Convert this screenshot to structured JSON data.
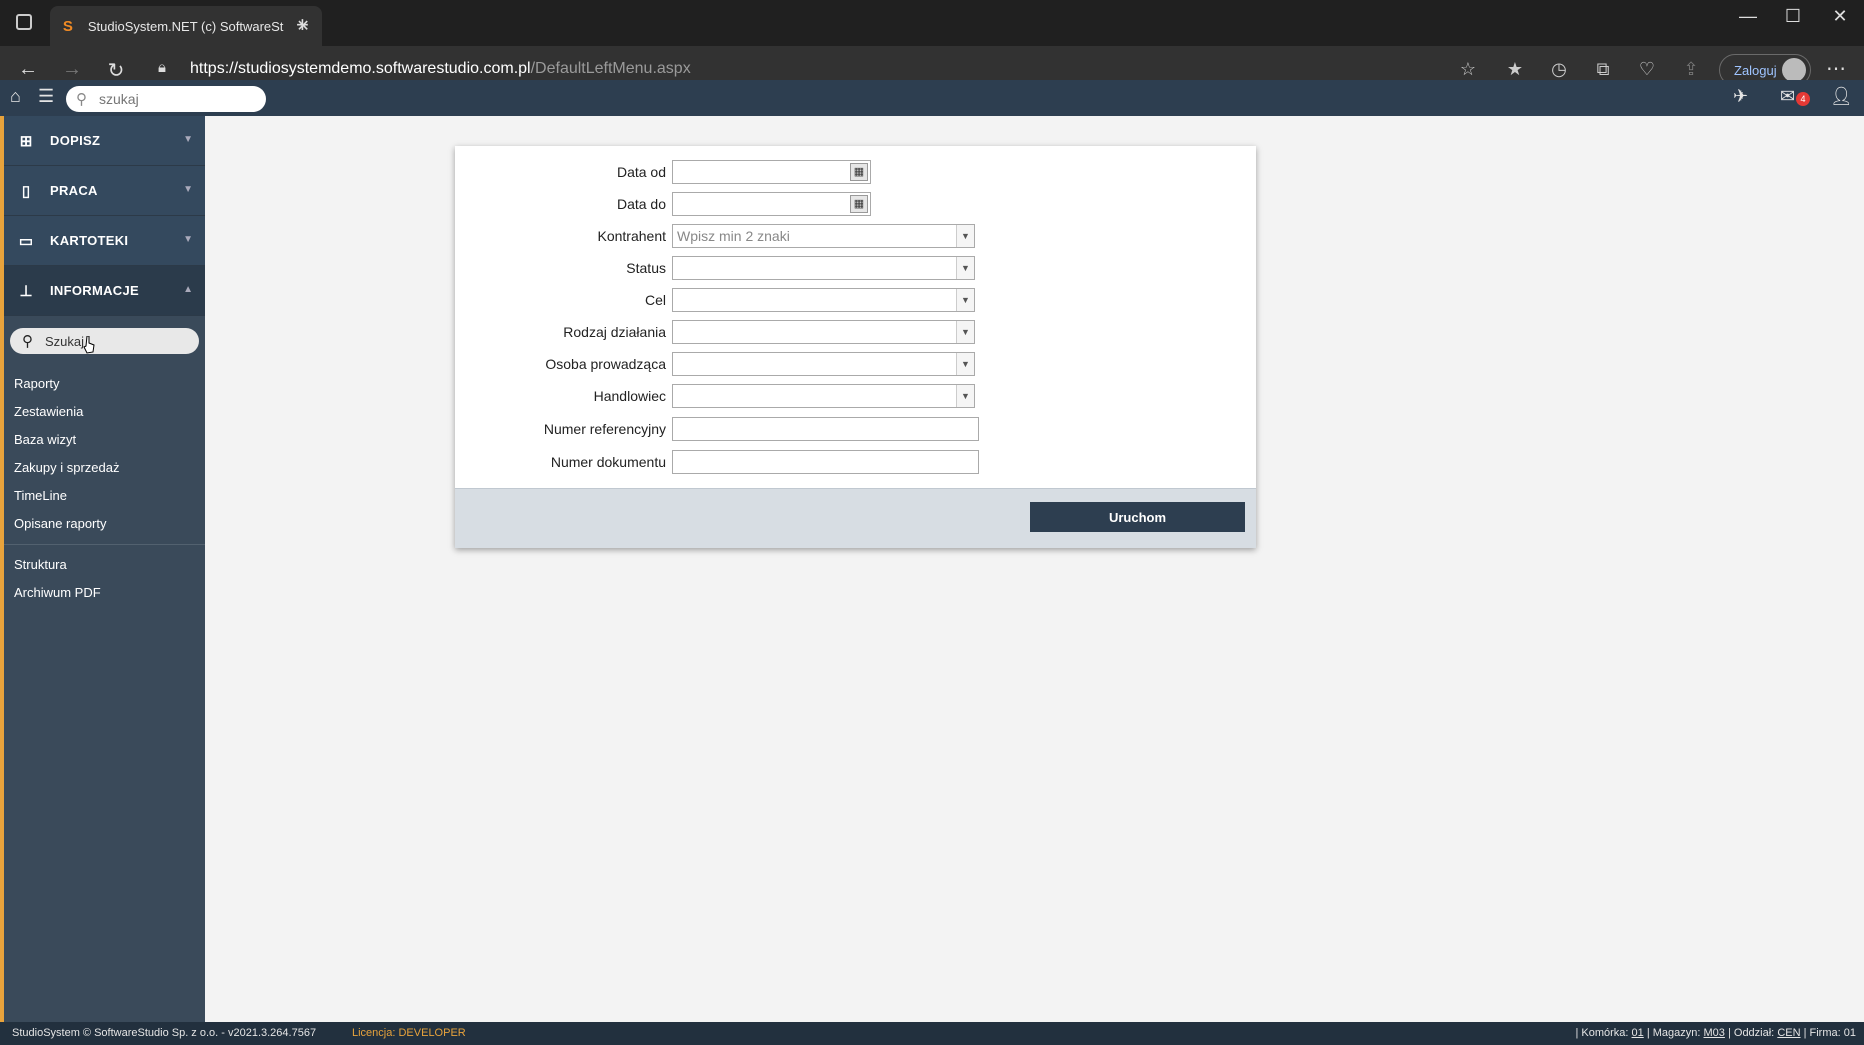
{
  "browser": {
    "tab_title": "StudioSystem.NET (c) SoftwareSt",
    "tab_favicon": "S",
    "url_main": "https://studiosystemdemo.softwarestudio.com.pl",
    "url_path": "/DefaultLeftMenu.aspx",
    "login_label": "Zaloguj"
  },
  "app": {
    "search_placeholder": "szukaj",
    "mail_count": "4"
  },
  "sidebar": {
    "menu": [
      {
        "label": "DOPISZ",
        "icon": "plus-square-icon"
      },
      {
        "label": "PRACA",
        "icon": "document-icon"
      },
      {
        "label": "KARTOTEKI",
        "icon": "folder-icon"
      },
      {
        "label": "INFORMACJE",
        "icon": "sitemap-icon"
      }
    ],
    "search_value": "Szukaj",
    "links_group1": [
      "Raporty",
      "Zestawienia",
      "Baza wizyt",
      "Zakupy i sprzedaż",
      "TimeLine",
      "Opisane raporty"
    ],
    "links_group2": [
      "Struktura",
      "Archiwum PDF"
    ]
  },
  "form": {
    "date_from_label": "Data od",
    "date_to_label": "Data do",
    "contractor_label": "Kontrahent",
    "contractor_placeholder": "Wpisz min 2 znaki",
    "status_label": "Status",
    "goal_label": "Cel",
    "action_type_label": "Rodzaj działania",
    "lead_person_label": "Osoba prowadząca",
    "salesman_label": "Handlowiec",
    "ref_number_label": "Numer referencyjny",
    "doc_number_label": "Numer dokumentu",
    "run_button": "Uruchom"
  },
  "statusbar": {
    "copyright": "StudioSystem © SoftwareStudio Sp. z o.o. - v2021.3.264.7567",
    "license_label": "Licencja:",
    "license_value": "DEVELOPER",
    "cell_label": "| Komórka:",
    "cell_value": "01",
    "warehouse_label": "| Magazyn:",
    "warehouse_value": "M03",
    "branch_label": "| Oddział:",
    "branch_value": "CEN",
    "company_label": "| Firma:",
    "company_value": "01"
  },
  "colors": {
    "sidebar_bg": "#34495e",
    "sidebar_accent": "#e8a33c",
    "topbar_bg": "#2d3e50",
    "button_bg": "#2d3e50"
  }
}
